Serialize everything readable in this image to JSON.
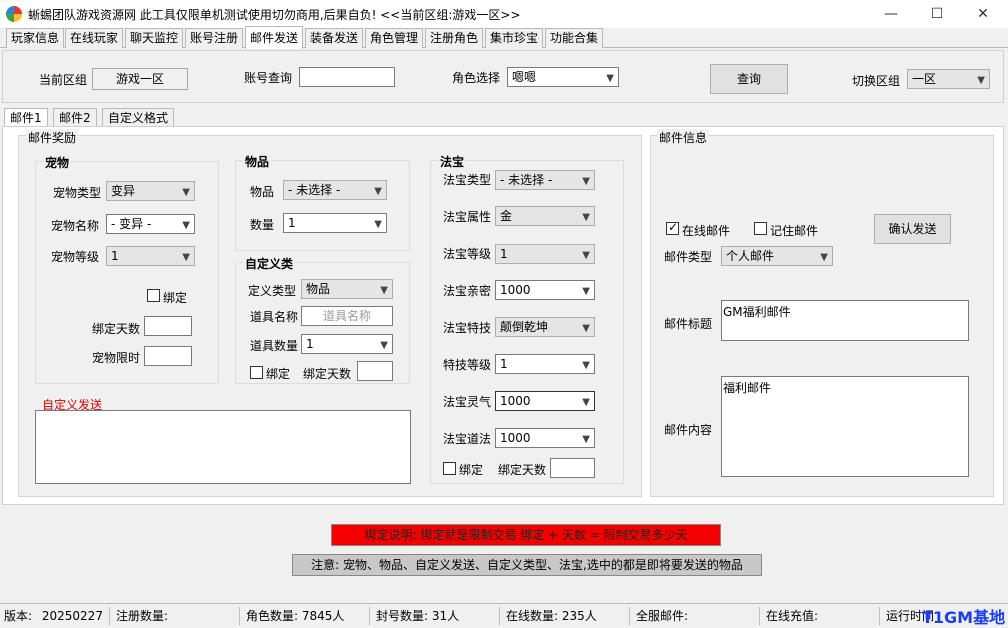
{
  "window": {
    "title": "蜥蜴团队游戏资源网 此工具仅限单机测试使用切勿商用,后果自负! <<当前区组:游戏一区>>",
    "minimize_glyph": "—",
    "maximize_glyph": "☐",
    "close_glyph": "✕"
  },
  "menu_tabs": [
    "玩家信息",
    "在线玩家",
    "聊天监控",
    "账号注册",
    "邮件发送",
    "装备发送",
    "角色管理",
    "注册角色",
    "集市珍宝",
    "功能合集"
  ],
  "topbar": {
    "zone_label": "当前区组",
    "zone_value": "游戏一区",
    "account_label": "账号查询",
    "account_value": "",
    "role_label": "角色选择",
    "role_value": "嗯嗯",
    "query_button": "查询",
    "switch_label": "切换区组",
    "switch_value": "一区"
  },
  "sub_tabs": [
    "邮件1",
    "邮件2",
    "自定义格式"
  ],
  "mail_reward": {
    "title": "邮件奖励",
    "pet": {
      "title": "宠物",
      "type_label": "宠物类型",
      "type_value": "变异",
      "name_label": "宠物名称",
      "name_value": "- 变异 -",
      "level_label": "宠物等级",
      "level_value": "1",
      "bind_label": "绑定",
      "bind_days_label": "绑定天数",
      "time_limit_label": "宠物限时"
    },
    "item": {
      "title": "物品",
      "item_label": "物品",
      "item_value": "- 未选择 -",
      "qty_label": "数量",
      "qty_value": "1"
    },
    "custom": {
      "title": "自定义类",
      "type_label": "定义类型",
      "type_value": "物品",
      "name_label": "道具名称",
      "name_placeholder": "道具名称",
      "qty_label": "道具数量",
      "qty_value": "1",
      "bind_label": "绑定",
      "bind_days_label": "绑定天数"
    },
    "custom_send_label": "自定义发送",
    "fabao": {
      "title": "法宝",
      "type_label": "法宝类型",
      "type_value": "- 未选择 -",
      "attr_label": "法宝属性",
      "attr_value": "金",
      "level_label": "法宝等级",
      "level_value": "1",
      "intimacy_label": "法宝亲密",
      "intimacy_value": "1000",
      "skill_label": "法宝特技",
      "skill_value": "颠倒乾坤",
      "skill_level_label": "特技等级",
      "skill_level_value": "1",
      "spirit_label": "法宝灵气",
      "spirit_value": "1000",
      "dao_label": "法宝道法",
      "dao_value": "1000",
      "bind_label": "绑定",
      "bind_days_label": "绑定天数"
    }
  },
  "mail_info": {
    "title": "邮件信息",
    "online_label": "在线邮件",
    "remember_label": "记住邮件",
    "confirm_button": "确认发送",
    "type_label": "邮件类型",
    "type_value": "个人邮件",
    "subject_label": "邮件标题",
    "subject_value": "GM福利邮件",
    "content_label": "邮件内容",
    "content_value": "福利邮件"
  },
  "notes": {
    "bind_note": "绑定说明: 绑定就是限制交易 绑定 + 天数 = 限制交易多少天",
    "select_note": "注意: 宠物、物品、自定义发送、自定义类型、法宝,选中的都是即将要发送的物品"
  },
  "statusbar": {
    "version_label": "版本:",
    "version_value": "20250227",
    "reg_label": "注册数量:",
    "reg_value": "",
    "role_label": "角色数量:",
    "role_value": "7845人",
    "ban_label": "封号数量:",
    "ban_value": "31人",
    "online_label": "在线数量:",
    "online_value": "235人",
    "server_mail_label": "全服邮件:",
    "server_mail_value": "",
    "recharge_label": "在线充值:",
    "recharge_value": "",
    "runtime_label": "运行时间",
    "watermark": "T1GM基地"
  },
  "colors": {
    "red_bar": "#f50000",
    "gray_bar": "#c8c8c8",
    "watermark": "#1a3cff"
  }
}
